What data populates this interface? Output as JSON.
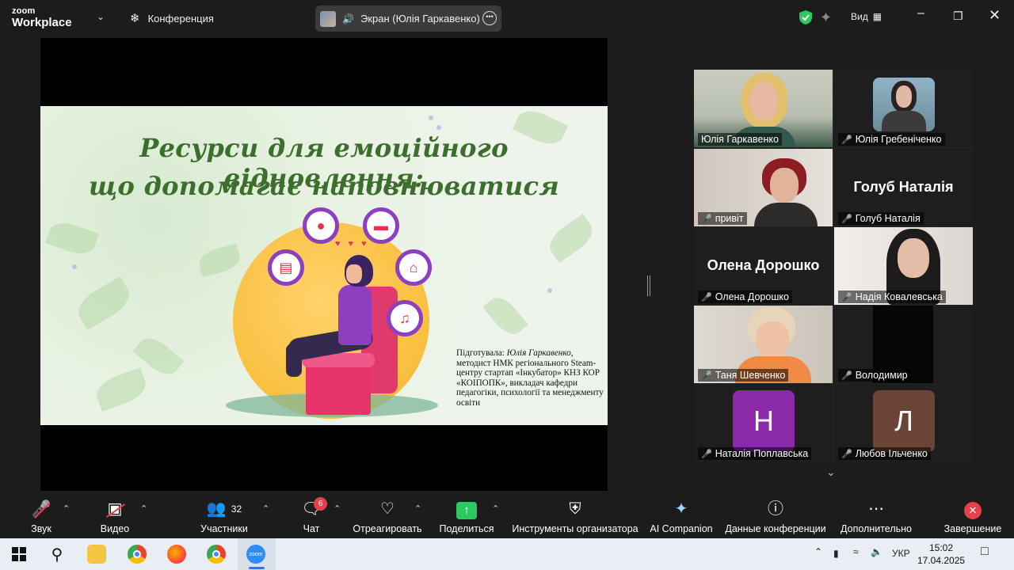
{
  "app": {
    "logo_line1": "zoom",
    "logo_line2": "Workplace"
  },
  "titlebar": {
    "conference_label": "Конференция",
    "screen_share_label": "Экран (Юлія Гаркавенко)",
    "view_label": "Вид"
  },
  "slide": {
    "title_line1": "Ресурси для емоційного відновлення:",
    "title_line2": "що допомагає наповнюватися",
    "credits_lead": "Підготувала: ",
    "credits_name": "Юлія Гаркавенко,",
    "credits_rest": "методист НМК регіонального Steam-центру стартап «Інкубатор» КНЗ КОР «КОІПОПК», викладач кафедри педагогіки, психології та менеджменту освіти"
  },
  "participants": [
    {
      "name": "Юлія Гаркавенко",
      "type": "video",
      "active": true,
      "muted": false
    },
    {
      "name": "Юлія Гребеніченко",
      "type": "video",
      "muted": true
    },
    {
      "name": "привіт",
      "type": "video",
      "muted": true
    },
    {
      "name": "Голуб Наталія",
      "type": "name",
      "muted": true
    },
    {
      "name": "Олена Дорошко",
      "type": "name",
      "muted": true
    },
    {
      "name": "Надія Ковалевська",
      "type": "video",
      "muted": true
    },
    {
      "name": "Таня Шевченко",
      "type": "video",
      "muted": true
    },
    {
      "name": "Володимир",
      "type": "video",
      "muted": true
    },
    {
      "name": "Наталія Поплавська",
      "type": "avatar",
      "letter": "Н",
      "color": "#8a2aa8",
      "muted": true
    },
    {
      "name": "Любов Ільченко",
      "type": "avatar",
      "letter": "Л",
      "color": "#6b4438",
      "muted": true
    }
  ],
  "toolbar": {
    "mute": "Звук",
    "video": "Видео",
    "participants": "Участники",
    "participants_count": "32",
    "chat": "Чат",
    "chat_badge": "6",
    "react": "Отреагировать",
    "share": "Поделиться",
    "host_tools": "Инструменты организатора",
    "ai": "AI Companion",
    "meeting_info": "Данные конференции",
    "more": "Дополнительно",
    "end": "Завершение"
  },
  "taskbar": {
    "language": "УКР",
    "time": "15:02",
    "date": "17.04.2025",
    "zoom_app_label": "zoom"
  },
  "colors": {
    "active_border": "#3fd67a",
    "share_green": "#2dc95f",
    "end_red": "#e5414a",
    "title_green": "#3c6e2d"
  },
  "icons": [
    "zoom-logo",
    "paw-icon",
    "speaker-icon",
    "more-icon",
    "shield-check-icon",
    "sparkle-icon",
    "grid-icon",
    "minimize-icon",
    "restore-icon",
    "close-icon",
    "mic-off-icon",
    "video-off-icon",
    "participants-icon",
    "chat-icon",
    "heart-icon",
    "share-icon",
    "host-shield-icon",
    "ai-sparkle-icon",
    "info-icon",
    "more-dots-icon",
    "end-icon",
    "windows-icon",
    "search-icon",
    "folder-icon",
    "chrome-icon",
    "firefox-icon",
    "chrome-profile-icon",
    "zoom-taskbar-icon",
    "chevron-up-icon",
    "battery-icon",
    "wifi-icon",
    "volume-icon",
    "notification-icon"
  ]
}
